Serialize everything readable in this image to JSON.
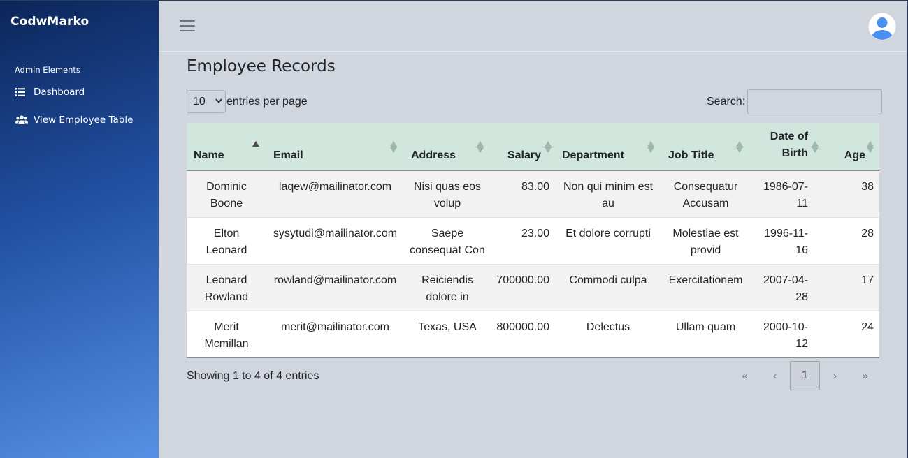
{
  "sidebar": {
    "brand": "CodwMarko",
    "section_label": "Admin Elements",
    "items": [
      {
        "label": "Dashboard",
        "icon": "list-icon"
      },
      {
        "label": "View Employee Table",
        "icon": "users-icon"
      }
    ]
  },
  "header": {
    "menu_icon": "hamburger-icon",
    "avatar_icon": "user-avatar-icon"
  },
  "main": {
    "title": "Employee Records",
    "length": {
      "selected": "10",
      "label": "entries per page"
    },
    "search": {
      "label": "Search:",
      "value": ""
    },
    "table": {
      "columns": [
        "Name",
        "Email",
        "Address",
        "Salary",
        "Department",
        "Job Title",
        "Date of Birth",
        "Age"
      ],
      "rows": [
        [
          "Dominic Boone",
          "laqew@mailinator.com",
          "Nisi quas eos volup",
          "83.00",
          "Non qui minim est au",
          "Consequatur Accusam",
          "1986-07-11",
          "38"
        ],
        [
          "Elton Leonard",
          "sysytudi@mailinator.com",
          "Saepe consequat Con",
          "23.00",
          "Et dolore corrupti",
          "Molestiae est provid",
          "1996-11-16",
          "28"
        ],
        [
          "Leonard Rowland",
          "rowland@mailinator.com",
          "Reiciendis dolore in",
          "700000.00",
          "Commodi culpa",
          "Exercitationem",
          "2007-04-28",
          "17"
        ],
        [
          "Merit Mcmillan",
          "merit@mailinator.com",
          "Texas, USA",
          "800000.00",
          "Delectus",
          "Ullam quam",
          "2000-10-12",
          "24"
        ]
      ]
    },
    "info": "Showing 1 to 4 of 4 entries",
    "pagination": {
      "first": "«",
      "prev": "‹",
      "current": "1",
      "next": "›",
      "last": "»"
    }
  }
}
